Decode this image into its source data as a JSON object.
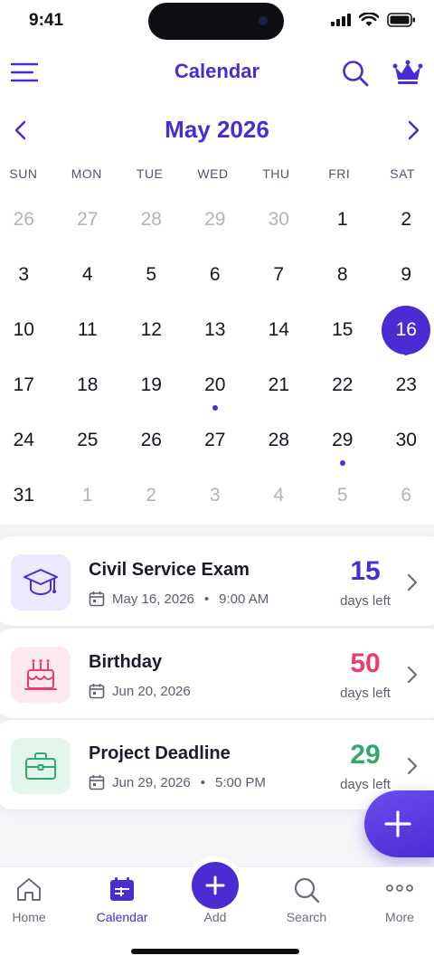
{
  "status_bar": {
    "time": "9:41"
  },
  "header": {
    "title": "Calendar",
    "menu_icon": "menu-icon",
    "search_icon": "search-icon",
    "premium_icon": "crown-icon"
  },
  "colors": {
    "accent": "#4a2cd2",
    "pink": "#e83e6c",
    "green": "#2faa6a",
    "purple_soft": "#ece8fd",
    "pink_soft": "#fde9ee",
    "green_soft": "#e2f6ec"
  },
  "month": {
    "label": "May 2026"
  },
  "weekdays": [
    "SUN",
    "MON",
    "TUE",
    "WED",
    "THU",
    "FRI",
    "SAT"
  ],
  "days": [
    {
      "n": "26",
      "muted": true
    },
    {
      "n": "27",
      "muted": true
    },
    {
      "n": "28",
      "muted": true
    },
    {
      "n": "29",
      "muted": true
    },
    {
      "n": "30",
      "muted": true
    },
    {
      "n": "1"
    },
    {
      "n": "2"
    },
    {
      "n": "3"
    },
    {
      "n": "4"
    },
    {
      "n": "5"
    },
    {
      "n": "6"
    },
    {
      "n": "7"
    },
    {
      "n": "8"
    },
    {
      "n": "9"
    },
    {
      "n": "10"
    },
    {
      "n": "11"
    },
    {
      "n": "12"
    },
    {
      "n": "13"
    },
    {
      "n": "14"
    },
    {
      "n": "15"
    },
    {
      "n": "16",
      "selected": true,
      "dot": true
    },
    {
      "n": "17"
    },
    {
      "n": "18"
    },
    {
      "n": "19"
    },
    {
      "n": "20",
      "dot": true
    },
    {
      "n": "21"
    },
    {
      "n": "22"
    },
    {
      "n": "23"
    },
    {
      "n": "24"
    },
    {
      "n": "25"
    },
    {
      "n": "26"
    },
    {
      "n": "27"
    },
    {
      "n": "28"
    },
    {
      "n": "29",
      "dot": true
    },
    {
      "n": "30"
    },
    {
      "n": "31"
    },
    {
      "n": "1",
      "muted": true
    },
    {
      "n": "2",
      "muted": true
    },
    {
      "n": "3",
      "muted": true
    },
    {
      "n": "4",
      "muted": true
    },
    {
      "n": "5",
      "muted": true
    },
    {
      "n": "6",
      "muted": true
    }
  ],
  "events": [
    {
      "title": "Civil Service Exam",
      "date": "May 16, 2026",
      "time": "9:00 AM",
      "count": "15",
      "days_left": "days left",
      "icon": "graduation-cap-icon"
    },
    {
      "title": "Birthday",
      "date": "Jun 20, 2026",
      "time": "",
      "count": "50",
      "days_left": "days left",
      "icon": "cake-icon"
    },
    {
      "title": "Project Deadline",
      "date": "Jun 29, 2026",
      "time": "5:00 PM",
      "count": "29",
      "days_left": "days left",
      "icon": "briefcase-icon"
    }
  ],
  "nav": [
    {
      "label": "Home",
      "icon": "home-icon"
    },
    {
      "label": "Calendar",
      "icon": "calendar-icon",
      "active": true
    },
    {
      "label": "Add",
      "icon": "plus-icon"
    },
    {
      "label": "Search",
      "icon": "search-icon"
    },
    {
      "label": "More",
      "icon": "more-icon"
    }
  ]
}
